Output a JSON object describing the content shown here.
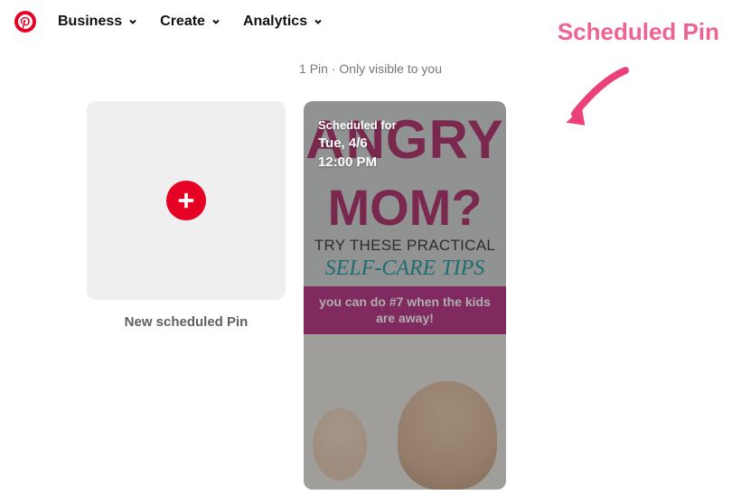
{
  "nav": {
    "items": [
      {
        "label": "Business"
      },
      {
        "label": "Create"
      },
      {
        "label": "Analytics"
      }
    ]
  },
  "page_subtitle": "1 Pin · Only visible to you",
  "new_pin": {
    "label": "New scheduled Pin"
  },
  "pin": {
    "scheduled_for_label": "Scheduled for",
    "scheduled_date": "Tue, 4/6",
    "scheduled_time": "12:00 PM",
    "headline1": "ANGRY",
    "headline2": "MOM?",
    "subline1": "TRY THESE PRACTICAL",
    "subline2": "SELF-CARE TIPS",
    "band": "you can do #7 when the kids are away!"
  },
  "annotation": {
    "label": "Scheduled Pin"
  }
}
